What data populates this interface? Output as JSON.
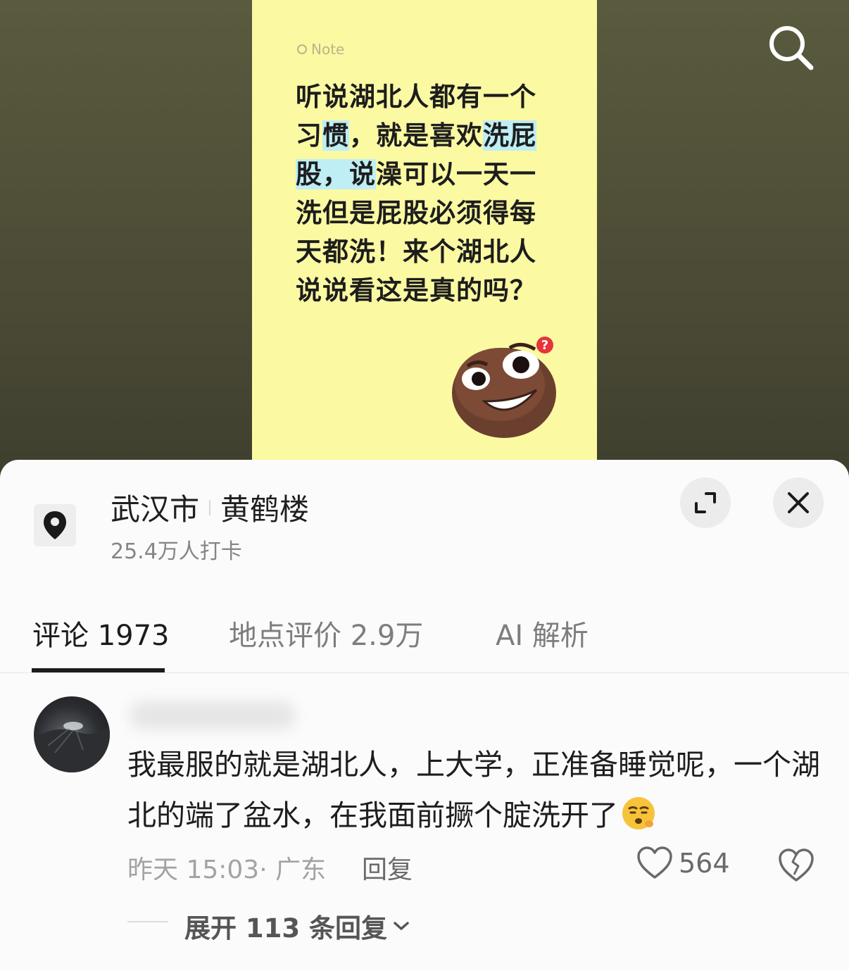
{
  "note": {
    "tag": "Note",
    "text_parts": [
      {
        "t": "听说湖北人都有一个习",
        "hl": false
      },
      {
        "t": "惯",
        "hl": true
      },
      {
        "t": "，就是喜欢",
        "hl": false
      },
      {
        "t": "洗屁股，说",
        "hl": true
      },
      {
        "t": "澡可以一天一洗但是屁股必须得每天都洗！来个湖北人说说看这是真的吗？",
        "hl": false
      }
    ]
  },
  "location": {
    "city": "武汉市",
    "place": "黄鹤楼",
    "checkins": "25.4万人打卡"
  },
  "tabs": [
    {
      "label": "评论 1973",
      "active": true
    },
    {
      "label": "地点评价 2.9万",
      "active": false
    },
    {
      "label": "AI 解析",
      "active": false
    }
  ],
  "comment": {
    "text": "我最服的就是湖北人，上大学，正准备睡觉呢，一个湖北的端了盆水，在我面前撅个腚洗开了",
    "meta": "昨天 15:03· 广东",
    "reply_label": "回复",
    "likes": "564",
    "expand_label": "展开 113 条回复"
  },
  "icons": {
    "search": "search-icon",
    "location": "location-pin-icon",
    "expand": "expand-icon",
    "close": "close-icon",
    "like": "heart-icon",
    "dislike": "broken-heart-icon",
    "chevron": "chevron-down-icon"
  }
}
